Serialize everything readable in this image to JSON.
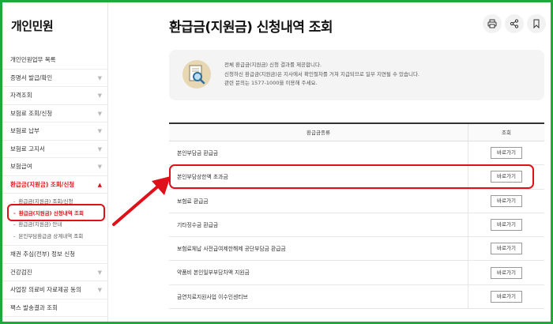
{
  "sidebar": {
    "title": "개인민원",
    "items": [
      {
        "label": "개인민원업무 목록",
        "chevron": false
      },
      {
        "label": "증명서 발급/확인",
        "chevron": true
      },
      {
        "label": "자격조회",
        "chevron": true
      },
      {
        "label": "보험료 조회/신청",
        "chevron": true
      },
      {
        "label": "보험료 납부",
        "chevron": true
      },
      {
        "label": "보험료 고지서",
        "chevron": true
      },
      {
        "label": "보험급여",
        "chevron": true
      }
    ],
    "active_item": {
      "label": "환급금(지원금) 조회/신청"
    },
    "sub_items": [
      {
        "label": "환급금(지원금) 조회/신청"
      },
      {
        "label": "환급금(지원금) 신청내역 조회"
      },
      {
        "label": "환급금(지원금) 안내"
      },
      {
        "label": "본인부담환급금 상계내역 조회"
      }
    ],
    "after_items": [
      {
        "label": "채권 추심(전부) 정보 신청",
        "chevron": false
      },
      {
        "label": "건강검진",
        "chevron": true
      },
      {
        "label": "사업장 의료비 자료제공 동의",
        "chevron": true
      },
      {
        "label": "팩스 발송결과 조회",
        "chevron": false
      }
    ]
  },
  "main": {
    "title": "환급금(지원금) 신청내역 조회",
    "tools": [
      {
        "name": "print-icon"
      },
      {
        "name": "share-icon"
      },
      {
        "name": "bookmark-icon"
      }
    ],
    "notice": {
      "lines": [
        "전체 환급금(지원금) 신청 결과를 제공합니다.",
        "신청하신 환급금(지원금)은 지사에서 확인절차를 거쳐 지급되므로 일부 지연될 수 있습니다.",
        "관련 문의는 1577-1000을 이용해 주세요."
      ]
    },
    "table": {
      "headers": [
        "환급금종류",
        "조회"
      ],
      "button_label": "바로가기",
      "rows": [
        {
          "label": "본인부담금 환급금"
        },
        {
          "label": "본인부담상한액 초과금"
        },
        {
          "label": "보험료 환급금"
        },
        {
          "label": "기타징수금 환급금"
        },
        {
          "label": "보험료체납 사전급여제한해제 공단부담금 환급금"
        },
        {
          "label": "약품비 본인일부부담차액 지원금"
        },
        {
          "label": "금연치료지원사업 이수인센티브"
        }
      ]
    }
  },
  "colors": {
    "frame": "#21a83a",
    "highlight": "#e0101a",
    "active": "#dd1111"
  }
}
